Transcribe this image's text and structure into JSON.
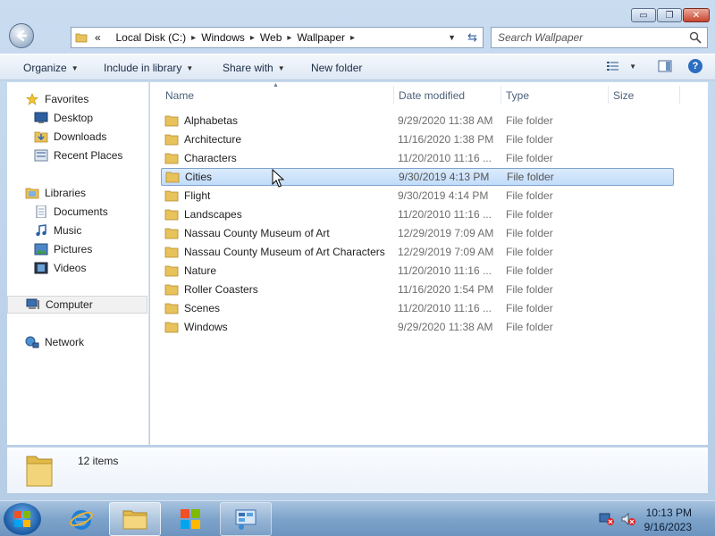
{
  "window": {
    "controls": {
      "minimize": "▭",
      "maximize": "❐",
      "close": "✕"
    }
  },
  "address": {
    "overflow": "«",
    "crumbs": [
      "Local Disk (C:)",
      "Windows",
      "Web",
      "Wallpaper"
    ],
    "search_placeholder": "Search Wallpaper"
  },
  "commands": {
    "organize": "Organize",
    "include": "Include in library",
    "share": "Share with",
    "new_folder": "New folder",
    "help": "?"
  },
  "nav": {
    "favorites": "Favorites",
    "desktop": "Desktop",
    "downloads": "Downloads",
    "recent": "Recent Places",
    "libraries": "Libraries",
    "documents": "Documents",
    "music": "Music",
    "pictures": "Pictures",
    "videos": "Videos",
    "computer": "Computer",
    "network": "Network"
  },
  "columns": {
    "name": "Name",
    "date": "Date modified",
    "type": "Type",
    "size": "Size"
  },
  "files": [
    {
      "name": "Alphabetas",
      "date": "9/29/2020 11:38 AM",
      "type": "File folder"
    },
    {
      "name": "Architecture",
      "date": "11/16/2020 1:38 PM",
      "type": "File folder"
    },
    {
      "name": "Characters",
      "date": "11/20/2010 11:16 ...",
      "type": "File folder"
    },
    {
      "name": "Cities",
      "date": "9/30/2019 4:13 PM",
      "type": "File folder"
    },
    {
      "name": "Flight",
      "date": "9/30/2019 4:14 PM",
      "type": "File folder"
    },
    {
      "name": "Landscapes",
      "date": "11/20/2010 11:16 ...",
      "type": "File folder"
    },
    {
      "name": "Nassau County Museum of Art",
      "date": "12/29/2019 7:09 AM",
      "type": "File folder"
    },
    {
      "name": "Nassau County Museum of Art Characters",
      "date": "12/29/2019 7:09 AM",
      "type": "File folder"
    },
    {
      "name": "Nature",
      "date": "11/20/2010 11:16 ...",
      "type": "File folder"
    },
    {
      "name": "Roller Coasters",
      "date": "11/16/2020 1:54 PM",
      "type": "File folder"
    },
    {
      "name": "Scenes",
      "date": "11/20/2010 11:16 ...",
      "type": "File folder"
    },
    {
      "name": "Windows",
      "date": "9/29/2020 11:38 AM",
      "type": "File folder"
    }
  ],
  "status": {
    "count": "12 items"
  },
  "taskbar": {
    "time": "10:13 PM",
    "date": "9/16/2023"
  }
}
